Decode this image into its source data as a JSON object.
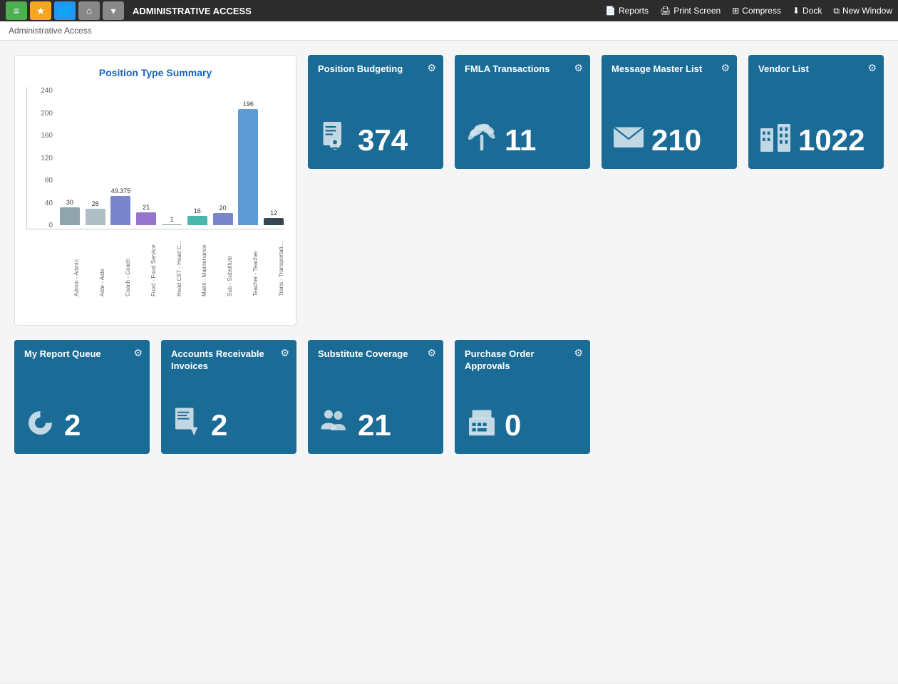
{
  "app": {
    "title": "ADMINISTRATIVE ACCESS",
    "breadcrumb": "Administrative Access"
  },
  "nav": {
    "icons": [
      "≡",
      "★",
      "🌐",
      "⌂",
      "▾"
    ],
    "actions": [
      {
        "label": "Reports",
        "icon": "📄"
      },
      {
        "label": "Print Screen",
        "icon": "🖨"
      },
      {
        "label": "Compress",
        "icon": "⊞"
      },
      {
        "label": "Dock",
        "icon": "⬇"
      },
      {
        "label": "New Window",
        "icon": "⧉"
      }
    ]
  },
  "chart": {
    "title": "Position Type Summary",
    "yLabels": [
      "240",
      "200",
      "160",
      "120",
      "80",
      "40",
      "0"
    ],
    "bars": [
      {
        "label": "Admin - Admin",
        "value": 30,
        "color": "#90a4ae",
        "display": "30"
      },
      {
        "label": "Aide - Aide",
        "value": 28,
        "color": "#b0bec5",
        "display": "28"
      },
      {
        "label": "Coach - Coach",
        "value": 49.375,
        "color": "#7986cb",
        "display": "49.375"
      },
      {
        "label": "Food - Food Service",
        "value": 21,
        "color": "#9575cd",
        "display": "21"
      },
      {
        "label": "Head CST - Head C...",
        "value": 1,
        "color": "#78909c",
        "display": "1"
      },
      {
        "label": "Maint - Maintenance",
        "value": 16,
        "color": "#4db6ac",
        "display": "16"
      },
      {
        "label": "Sub - Substitute",
        "value": 20,
        "color": "#7986cb",
        "display": "20"
      },
      {
        "label": "Teacher - Teacher",
        "value": 196,
        "color": "#5c9bd4",
        "display": "196"
      },
      {
        "label": "Trans - Transportati...",
        "value": 12,
        "color": "#37474f",
        "display": "12"
      }
    ],
    "maxValue": 240
  },
  "tiles_top": [
    {
      "id": "position-budgeting",
      "title": "Position Budgeting",
      "number": "374",
      "icon": "person-doc"
    },
    {
      "id": "fmla-transactions",
      "title": "FMLA Transactions",
      "number": "11",
      "icon": "palm-tree"
    },
    {
      "id": "message-master-list",
      "title": "Message Master List",
      "number": "210",
      "icon": "envelope"
    },
    {
      "id": "vendor-list",
      "title": "Vendor List",
      "number": "1022",
      "icon": "building"
    }
  ],
  "tiles_bottom": [
    {
      "id": "my-report-queue",
      "title": "My Report Queue",
      "number": "2",
      "icon": "pie-chart"
    },
    {
      "id": "accounts-receivable",
      "title": "Accounts Receivable Invoices",
      "number": "2",
      "icon": "invoice-down"
    },
    {
      "id": "substitute-coverage",
      "title": "Substitute Coverage",
      "number": "21",
      "icon": "people"
    },
    {
      "id": "purchase-order",
      "title": "Purchase Order Approvals",
      "number": "0",
      "icon": "register"
    }
  ]
}
